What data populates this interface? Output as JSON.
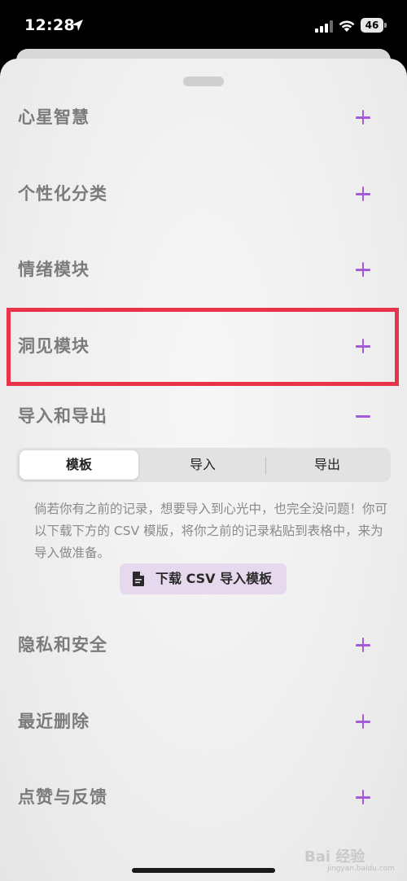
{
  "status_bar": {
    "time": "12:28",
    "battery": "46",
    "icons": [
      "location-arrow-icon",
      "cellular-signal-icon",
      "wifi-icon",
      "battery-icon"
    ]
  },
  "sections": [
    {
      "title": "心星智慧",
      "icon": "plus-icon",
      "expanded": false
    },
    {
      "title": "个性化分类",
      "icon": "plus-icon",
      "expanded": false
    },
    {
      "title": "情绪模块",
      "icon": "plus-icon",
      "expanded": false
    },
    {
      "title": "洞见模块",
      "icon": "plus-icon",
      "expanded": false,
      "highlighted": true
    },
    {
      "title": "导入和导出",
      "icon": "minus-icon",
      "expanded": true
    },
    {
      "title": "隐私和安全",
      "icon": "plus-icon",
      "expanded": false
    },
    {
      "title": "最近删除",
      "icon": "plus-icon",
      "expanded": false
    },
    {
      "title": "点赞与反馈",
      "icon": "plus-icon",
      "expanded": false
    }
  ],
  "import_export": {
    "tabs": [
      {
        "label": "模板",
        "selected": true
      },
      {
        "label": "导入",
        "selected": false
      },
      {
        "label": "导出",
        "selected": false
      }
    ],
    "description": "倘若你有之前的记录，想要导入到心光中，也完全没问题！你可以下载下方的 CSV 模版，将你之前的记录粘贴到表格中，来为导入做准备。",
    "download_button": "下载 CSV 导入模板"
  },
  "watermark": {
    "brand": "Bai 经验",
    "domain": "jingyan.baidu.com"
  },
  "colors": {
    "accent": "#a45bd6",
    "highlight_border": "#e8334a",
    "section_title": "#7b7b7b",
    "button_bg": "#e6d9ee"
  }
}
